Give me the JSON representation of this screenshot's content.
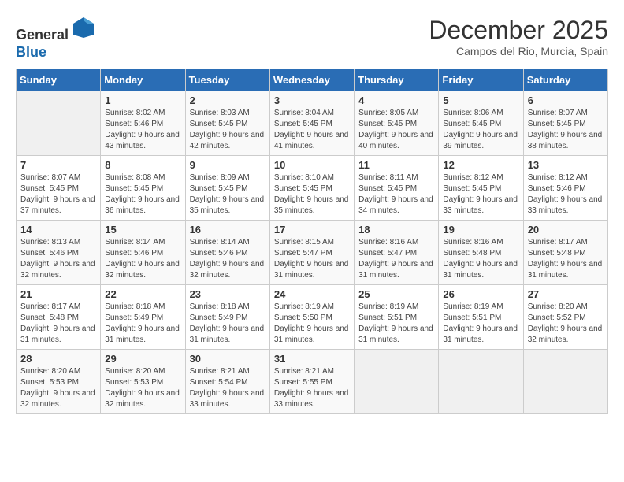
{
  "header": {
    "logo_general": "General",
    "logo_blue": "Blue",
    "month_title": "December 2025",
    "location": "Campos del Rio, Murcia, Spain"
  },
  "weekdays": [
    "Sunday",
    "Monday",
    "Tuesday",
    "Wednesday",
    "Thursday",
    "Friday",
    "Saturday"
  ],
  "weeks": [
    [
      {
        "day": "",
        "sunrise": "",
        "sunset": "",
        "daylight": ""
      },
      {
        "day": "1",
        "sunrise": "Sunrise: 8:02 AM",
        "sunset": "Sunset: 5:46 PM",
        "daylight": "Daylight: 9 hours and 43 minutes."
      },
      {
        "day": "2",
        "sunrise": "Sunrise: 8:03 AM",
        "sunset": "Sunset: 5:45 PM",
        "daylight": "Daylight: 9 hours and 42 minutes."
      },
      {
        "day": "3",
        "sunrise": "Sunrise: 8:04 AM",
        "sunset": "Sunset: 5:45 PM",
        "daylight": "Daylight: 9 hours and 41 minutes."
      },
      {
        "day": "4",
        "sunrise": "Sunrise: 8:05 AM",
        "sunset": "Sunset: 5:45 PM",
        "daylight": "Daylight: 9 hours and 40 minutes."
      },
      {
        "day": "5",
        "sunrise": "Sunrise: 8:06 AM",
        "sunset": "Sunset: 5:45 PM",
        "daylight": "Daylight: 9 hours and 39 minutes."
      },
      {
        "day": "6",
        "sunrise": "Sunrise: 8:07 AM",
        "sunset": "Sunset: 5:45 PM",
        "daylight": "Daylight: 9 hours and 38 minutes."
      }
    ],
    [
      {
        "day": "7",
        "sunrise": "Sunrise: 8:07 AM",
        "sunset": "Sunset: 5:45 PM",
        "daylight": "Daylight: 9 hours and 37 minutes."
      },
      {
        "day": "8",
        "sunrise": "Sunrise: 8:08 AM",
        "sunset": "Sunset: 5:45 PM",
        "daylight": "Daylight: 9 hours and 36 minutes."
      },
      {
        "day": "9",
        "sunrise": "Sunrise: 8:09 AM",
        "sunset": "Sunset: 5:45 PM",
        "daylight": "Daylight: 9 hours and 35 minutes."
      },
      {
        "day": "10",
        "sunrise": "Sunrise: 8:10 AM",
        "sunset": "Sunset: 5:45 PM",
        "daylight": "Daylight: 9 hours and 35 minutes."
      },
      {
        "day": "11",
        "sunrise": "Sunrise: 8:11 AM",
        "sunset": "Sunset: 5:45 PM",
        "daylight": "Daylight: 9 hours and 34 minutes."
      },
      {
        "day": "12",
        "sunrise": "Sunrise: 8:12 AM",
        "sunset": "Sunset: 5:45 PM",
        "daylight": "Daylight: 9 hours and 33 minutes."
      },
      {
        "day": "13",
        "sunrise": "Sunrise: 8:12 AM",
        "sunset": "Sunset: 5:46 PM",
        "daylight": "Daylight: 9 hours and 33 minutes."
      }
    ],
    [
      {
        "day": "14",
        "sunrise": "Sunrise: 8:13 AM",
        "sunset": "Sunset: 5:46 PM",
        "daylight": "Daylight: 9 hours and 32 minutes."
      },
      {
        "day": "15",
        "sunrise": "Sunrise: 8:14 AM",
        "sunset": "Sunset: 5:46 PM",
        "daylight": "Daylight: 9 hours and 32 minutes."
      },
      {
        "day": "16",
        "sunrise": "Sunrise: 8:14 AM",
        "sunset": "Sunset: 5:46 PM",
        "daylight": "Daylight: 9 hours and 32 minutes."
      },
      {
        "day": "17",
        "sunrise": "Sunrise: 8:15 AM",
        "sunset": "Sunset: 5:47 PM",
        "daylight": "Daylight: 9 hours and 31 minutes."
      },
      {
        "day": "18",
        "sunrise": "Sunrise: 8:16 AM",
        "sunset": "Sunset: 5:47 PM",
        "daylight": "Daylight: 9 hours and 31 minutes."
      },
      {
        "day": "19",
        "sunrise": "Sunrise: 8:16 AM",
        "sunset": "Sunset: 5:48 PM",
        "daylight": "Daylight: 9 hours and 31 minutes."
      },
      {
        "day": "20",
        "sunrise": "Sunrise: 8:17 AM",
        "sunset": "Sunset: 5:48 PM",
        "daylight": "Daylight: 9 hours and 31 minutes."
      }
    ],
    [
      {
        "day": "21",
        "sunrise": "Sunrise: 8:17 AM",
        "sunset": "Sunset: 5:48 PM",
        "daylight": "Daylight: 9 hours and 31 minutes."
      },
      {
        "day": "22",
        "sunrise": "Sunrise: 8:18 AM",
        "sunset": "Sunset: 5:49 PM",
        "daylight": "Daylight: 9 hours and 31 minutes."
      },
      {
        "day": "23",
        "sunrise": "Sunrise: 8:18 AM",
        "sunset": "Sunset: 5:49 PM",
        "daylight": "Daylight: 9 hours and 31 minutes."
      },
      {
        "day": "24",
        "sunrise": "Sunrise: 8:19 AM",
        "sunset": "Sunset: 5:50 PM",
        "daylight": "Daylight: 9 hours and 31 minutes."
      },
      {
        "day": "25",
        "sunrise": "Sunrise: 8:19 AM",
        "sunset": "Sunset: 5:51 PM",
        "daylight": "Daylight: 9 hours and 31 minutes."
      },
      {
        "day": "26",
        "sunrise": "Sunrise: 8:19 AM",
        "sunset": "Sunset: 5:51 PM",
        "daylight": "Daylight: 9 hours and 31 minutes."
      },
      {
        "day": "27",
        "sunrise": "Sunrise: 8:20 AM",
        "sunset": "Sunset: 5:52 PM",
        "daylight": "Daylight: 9 hours and 32 minutes."
      }
    ],
    [
      {
        "day": "28",
        "sunrise": "Sunrise: 8:20 AM",
        "sunset": "Sunset: 5:53 PM",
        "daylight": "Daylight: 9 hours and 32 minutes."
      },
      {
        "day": "29",
        "sunrise": "Sunrise: 8:20 AM",
        "sunset": "Sunset: 5:53 PM",
        "daylight": "Daylight: 9 hours and 32 minutes."
      },
      {
        "day": "30",
        "sunrise": "Sunrise: 8:21 AM",
        "sunset": "Sunset: 5:54 PM",
        "daylight": "Daylight: 9 hours and 33 minutes."
      },
      {
        "day": "31",
        "sunrise": "Sunrise: 8:21 AM",
        "sunset": "Sunset: 5:55 PM",
        "daylight": "Daylight: 9 hours and 33 minutes."
      },
      {
        "day": "",
        "sunrise": "",
        "sunset": "",
        "daylight": ""
      },
      {
        "day": "",
        "sunrise": "",
        "sunset": "",
        "daylight": ""
      },
      {
        "day": "",
        "sunrise": "",
        "sunset": "",
        "daylight": ""
      }
    ]
  ]
}
